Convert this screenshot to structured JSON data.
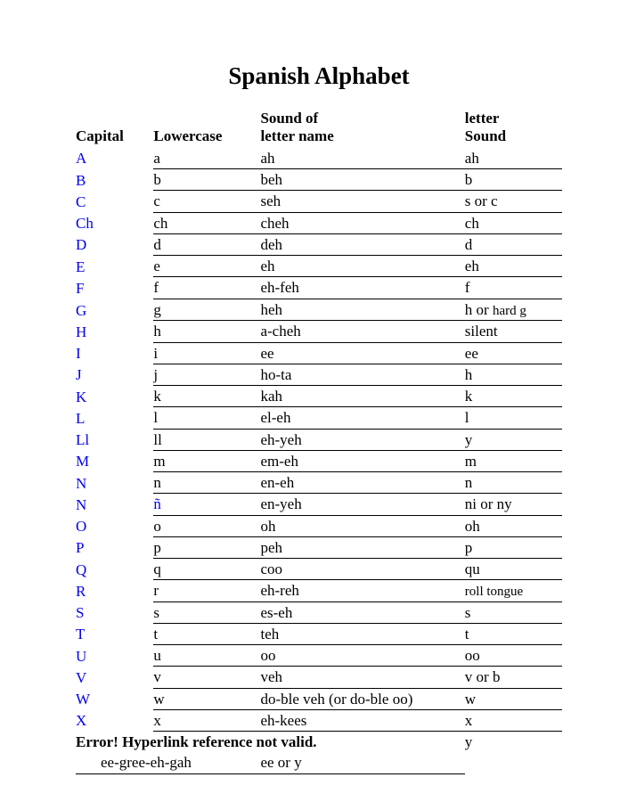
{
  "title": "Spanish Alphabet",
  "headers": {
    "capital": "Capital",
    "lowercase": "Lowercase",
    "name_line1": "Sound of",
    "name_line2": "letter name",
    "sound_line1": "letter",
    "sound_line2": "Sound"
  },
  "rows": [
    {
      "cap": "A",
      "low": "a",
      "name": "ah",
      "sound": "ah"
    },
    {
      "cap": "B",
      "low": "b",
      "name": "beh",
      "sound": "b"
    },
    {
      "cap": "C",
      "low": "c",
      "name": "seh",
      "sound": "s or c"
    },
    {
      "cap": "Ch",
      "low": "ch",
      "name": "cheh",
      "sound": "ch"
    },
    {
      "cap": "D",
      "low": "d",
      "name": "deh",
      "sound": "d"
    },
    {
      "cap": "E",
      "low": "e",
      "name": "eh",
      "sound": "eh"
    },
    {
      "cap": "F",
      "low": "f",
      "name": "eh-feh",
      "sound": "f"
    },
    {
      "cap": "G",
      "low": "g",
      "name": "heh",
      "sound": "h or hard g",
      "sound_special": true
    },
    {
      "cap": "H",
      "low": "h",
      "name": "a-cheh",
      "sound": "silent"
    },
    {
      "cap": "I",
      "low": "i",
      "name": "ee",
      "sound": "ee"
    },
    {
      "cap": "J",
      "low": "j",
      "name": "ho-ta",
      "sound": "h"
    },
    {
      "cap": "K",
      "low": "k",
      "name": "kah",
      "sound": "k"
    },
    {
      "cap": "L",
      "low": "l",
      "name": "el-eh",
      "sound": "l"
    },
    {
      "cap": "Ll",
      "low": "ll",
      "name": "eh-yeh",
      "sound": "y"
    },
    {
      "cap": "M",
      "low": "m",
      "name": "em-eh",
      "sound": "m"
    },
    {
      "cap": "N",
      "low": "n",
      "name": "en-eh",
      "sound": "n"
    },
    {
      "cap": "N",
      "low": "ñ",
      "name": "en-yeh",
      "sound": "ni or ny",
      "low_link": true
    },
    {
      "cap": "O",
      "low": "o",
      "name": "oh",
      "sound": "oh"
    },
    {
      "cap": "P",
      "low": "p",
      "name": "peh",
      "sound": "p"
    },
    {
      "cap": "Q",
      "low": "q",
      "name": "coo",
      "sound": "qu"
    },
    {
      "cap": "R",
      "low": "r",
      "name": "eh-reh",
      "sound": "roll tongue",
      "sound_small": true
    },
    {
      "cap": "S",
      "low": "s",
      "name": "es-eh",
      "sound": "s"
    },
    {
      "cap": "T",
      "low": "t",
      "name": "teh",
      "sound": "t"
    },
    {
      "cap": "U",
      "low": "u",
      "name": "oo",
      "sound": "oo"
    },
    {
      "cap": "V",
      "low": "v",
      "name": "veh",
      "sound": "v or b"
    },
    {
      "cap": "W",
      "low": "w",
      "name": "do-ble veh (or do-ble oo)",
      "sound": "w"
    },
    {
      "cap": "X",
      "low": "x",
      "name": "eh-kees",
      "sound": "x"
    }
  ],
  "error_text": "Error! Hyperlink reference not valid.",
  "error_sound": "y",
  "y_name": "ee-gree-eh-gah",
  "y_sound": "ee or y"
}
